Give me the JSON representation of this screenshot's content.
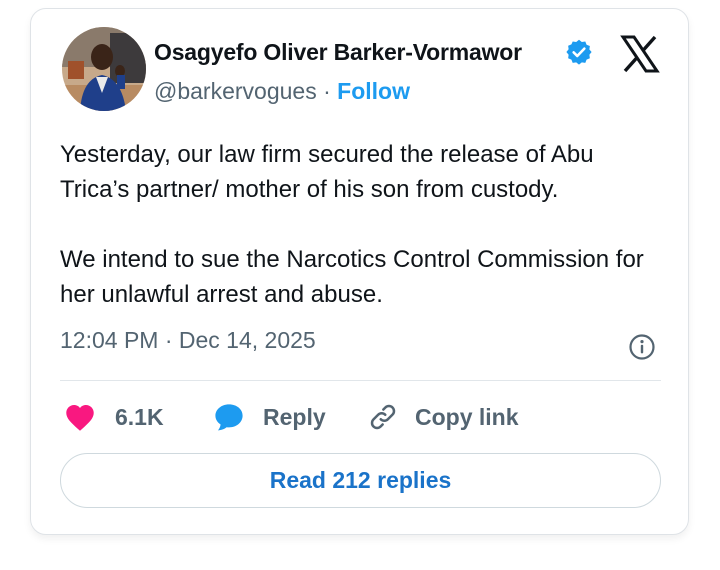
{
  "author": {
    "display_name": "Osagyefo Oliver Barker-Vormawor",
    "handle": "@barkervogues",
    "separator": "·",
    "follow_label": "Follow",
    "verified": true
  },
  "tweet": {
    "paragraphs": [
      "Yesterday, our law firm secured the release of Abu Trica’s partner/ mother of his son from custody.",
      "We intend to sue the Narcotics Control Commission for her unlawful arrest and abuse."
    ],
    "timestamp": "12:04 PM · Dec 14, 2025"
  },
  "actions": {
    "like_count": "6.1K",
    "reply_label": "Reply",
    "copy_link_label": "Copy link"
  },
  "read_replies_label": "Read 212 replies",
  "colors": {
    "like": "#f91880",
    "reply": "#1d9bf0",
    "follow": "#1d9bf0",
    "read_replies": "#1a73c9",
    "text_primary": "#0f1419",
    "text_secondary": "#536471"
  },
  "icons": {
    "avatar": "avatar-photo",
    "verified": "verified-badge-icon",
    "brand": "x-logo-icon",
    "info": "info-icon",
    "like": "heart-icon",
    "reply": "speech-bubble-icon",
    "copy_link": "link-icon"
  }
}
